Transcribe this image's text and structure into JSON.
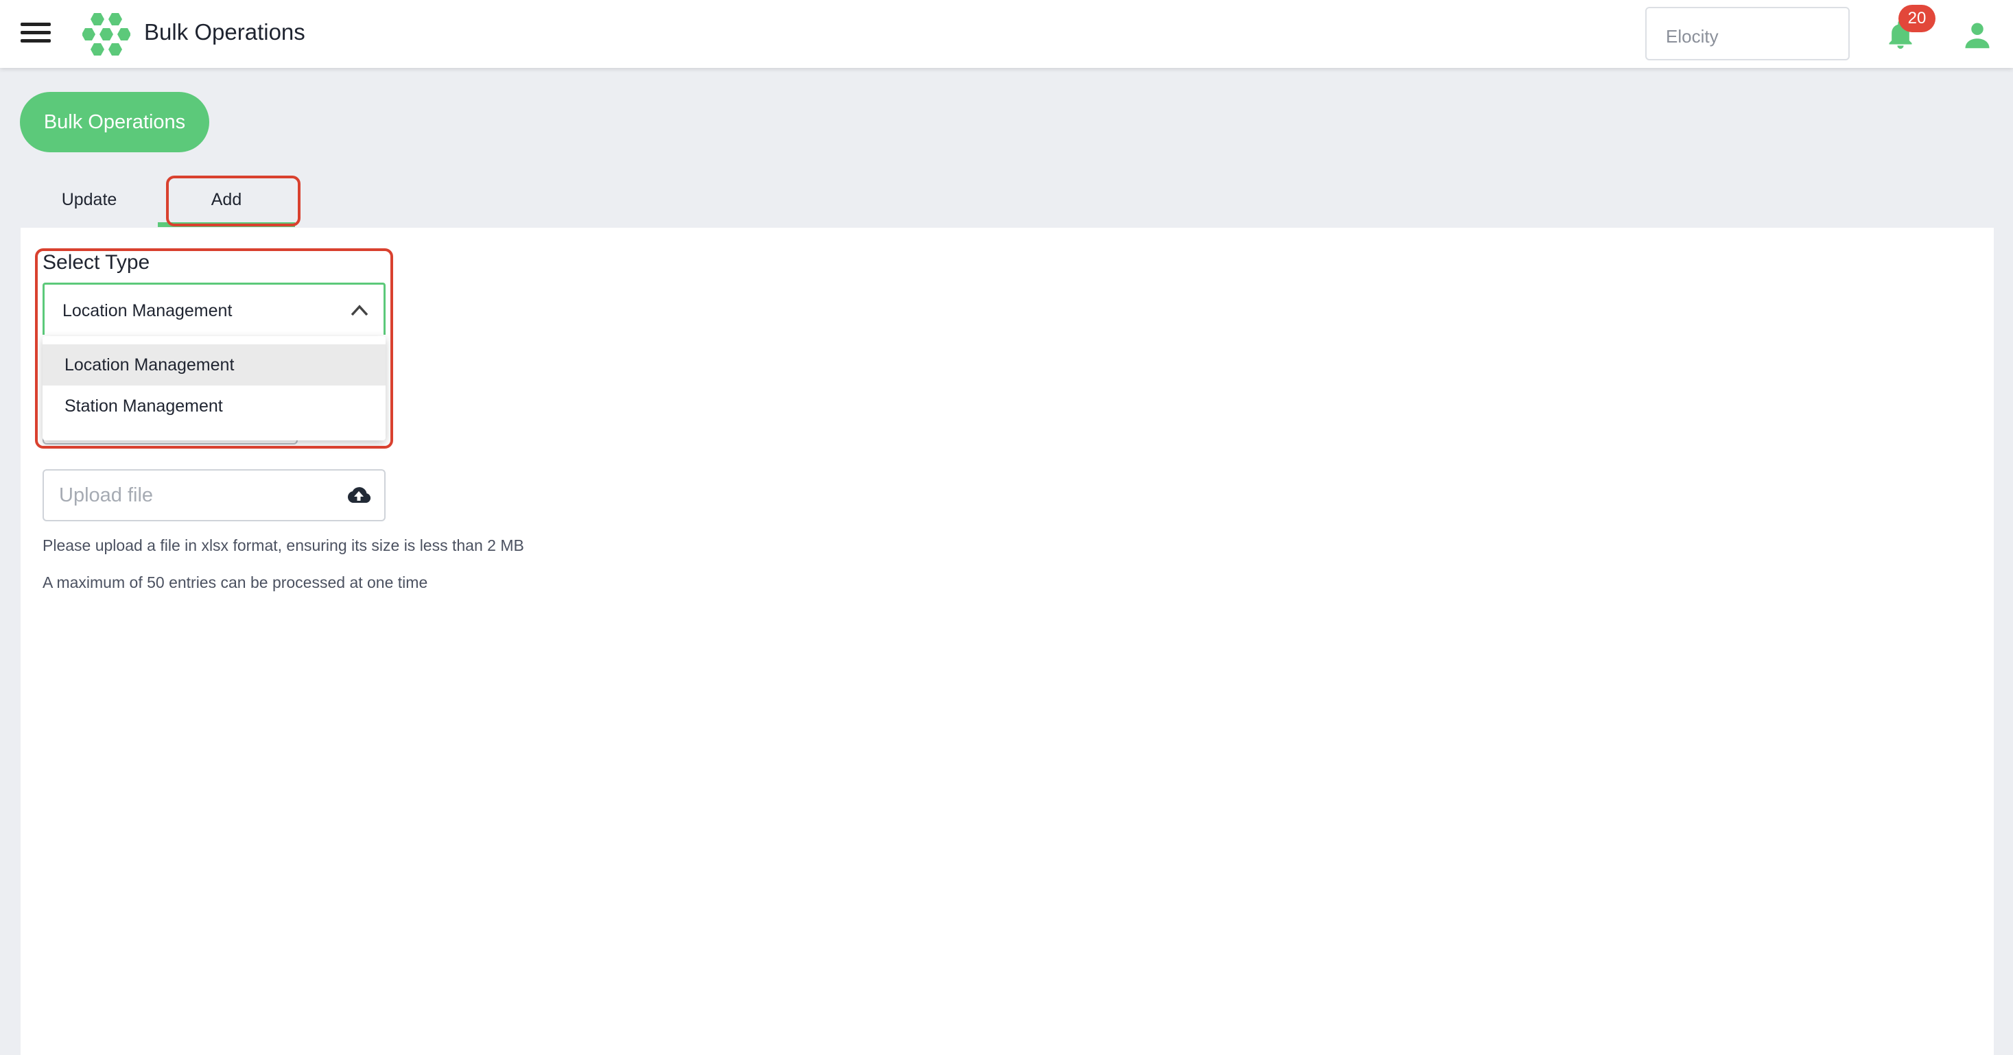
{
  "header": {
    "app_title": "Bulk Operations",
    "org_select_value": "Elocity",
    "notification_count": "20",
    "icons": [
      "menu-icon",
      "hexagon-logo-icon",
      "bell-icon",
      "user-icon"
    ]
  },
  "page": {
    "title_pill": "Bulk Operations",
    "tabs": [
      {
        "label": "Update",
        "selected": false
      },
      {
        "label": "Add",
        "selected": true
      }
    ]
  },
  "form": {
    "select_type_label": "Select Type",
    "select_type_value": "Location Management",
    "select_type_options": [
      "Location Management",
      "Station Management"
    ],
    "upload_placeholder": "Upload file",
    "upload_icon": "cloud-upload-icon",
    "help_text_1": "Please upload a file in xlsx format, ensuring its size is less than 2 MB",
    "help_text_2": "A maximum of 50 entries can be processed at one time"
  },
  "colors": {
    "accent": "#5cc97a",
    "highlight": "#d9412f",
    "badge": "#e2473a",
    "background": "#eceef2"
  }
}
